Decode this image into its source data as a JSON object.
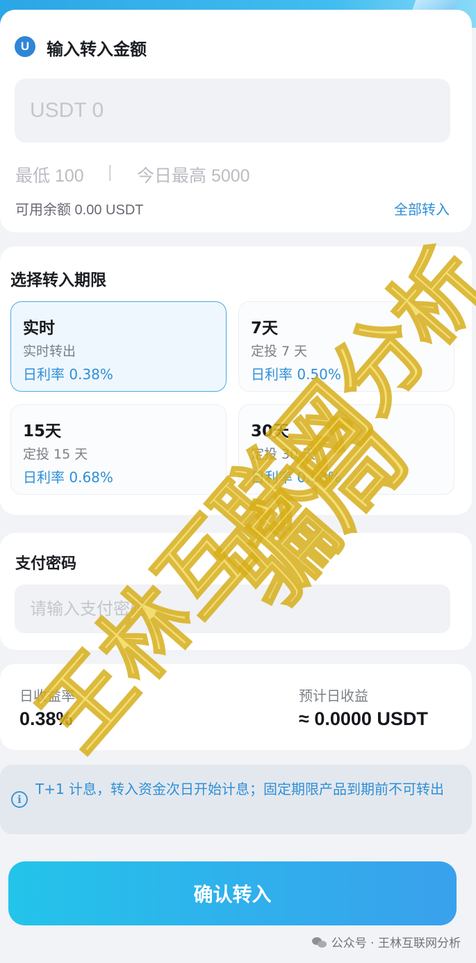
{
  "amount_section": {
    "badge": "U",
    "title": "输入转入金额",
    "placeholder": "USDT 0",
    "min_label": "最低 100",
    "separator": "|",
    "max_label": "今日最高 5000",
    "available": "可用余额 0.00 USDT",
    "transfer_all": "全部转入"
  },
  "term_section": {
    "title": "选择转入期限",
    "options": [
      {
        "name": "实时",
        "desc": "实时转出",
        "rate": "日利率 0.38%",
        "selected": true
      },
      {
        "name": "7天",
        "desc": "定投 7 天",
        "rate": "日利率 0.50%",
        "selected": false
      },
      {
        "name": "15天",
        "desc": "定投 15 天",
        "rate": "日利率 0.68%",
        "selected": false
      },
      {
        "name": "30天",
        "desc": "定投 30 天",
        "rate": "日利率 0.98%",
        "selected": false
      }
    ]
  },
  "password_section": {
    "title": "支付密码",
    "placeholder": "请输入支付密码"
  },
  "yield_section": {
    "rate_label": "日收益率",
    "rate_value": "0.38%",
    "daily_label": "预计日收益",
    "daily_value": "≈ 0.0000 USDT"
  },
  "notice": {
    "icon": "info-icon",
    "text": "T+1 计息，转入资金次日开始计息；固定期限产品到期前不可转出"
  },
  "confirm_button": "确认转入",
  "footer": {
    "icon": "wechat-icon",
    "text": "公众号 · 王林互联网分析"
  },
  "watermark": {
    "line1": "王林互联网分析",
    "line2": "骗局"
  },
  "colors": {
    "accent": "#2f8fd6",
    "button_start": "#23c4ea",
    "button_end": "#39a1ec",
    "watermark": "#f3da5a"
  }
}
